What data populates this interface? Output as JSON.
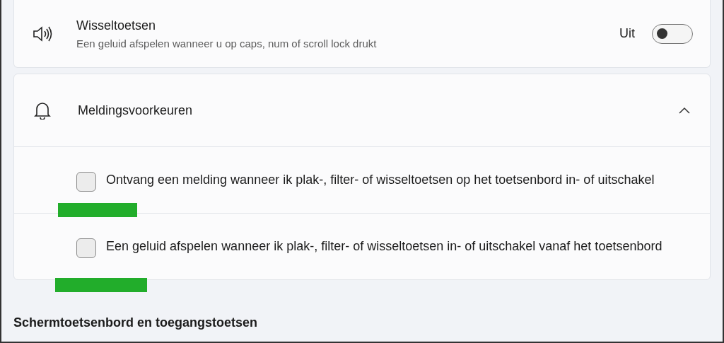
{
  "toggle_card": {
    "title": "Wisseltoetsen",
    "description": "Een geluid afspelen wanneer u op caps, num of scroll lock drukt",
    "state_label": "Uit",
    "on": false
  },
  "notifications": {
    "title": "Meldingsvoorkeuren",
    "expanded": true,
    "options": [
      {
        "label": "Ontvang een melding wanneer ik plak-, filter- of wisseltoetsen op het toetsenbord in- of uitschakel",
        "checked": false,
        "highlighted": true
      },
      {
        "label": "Een geluid afspelen wanneer ik plak-, filter- of wisseltoetsen in- of uitschakel vanaf het toetsenbord",
        "checked": false,
        "highlighted": true
      }
    ]
  },
  "section_heading": "Schermtoetsenbord en toegangstoetsen"
}
